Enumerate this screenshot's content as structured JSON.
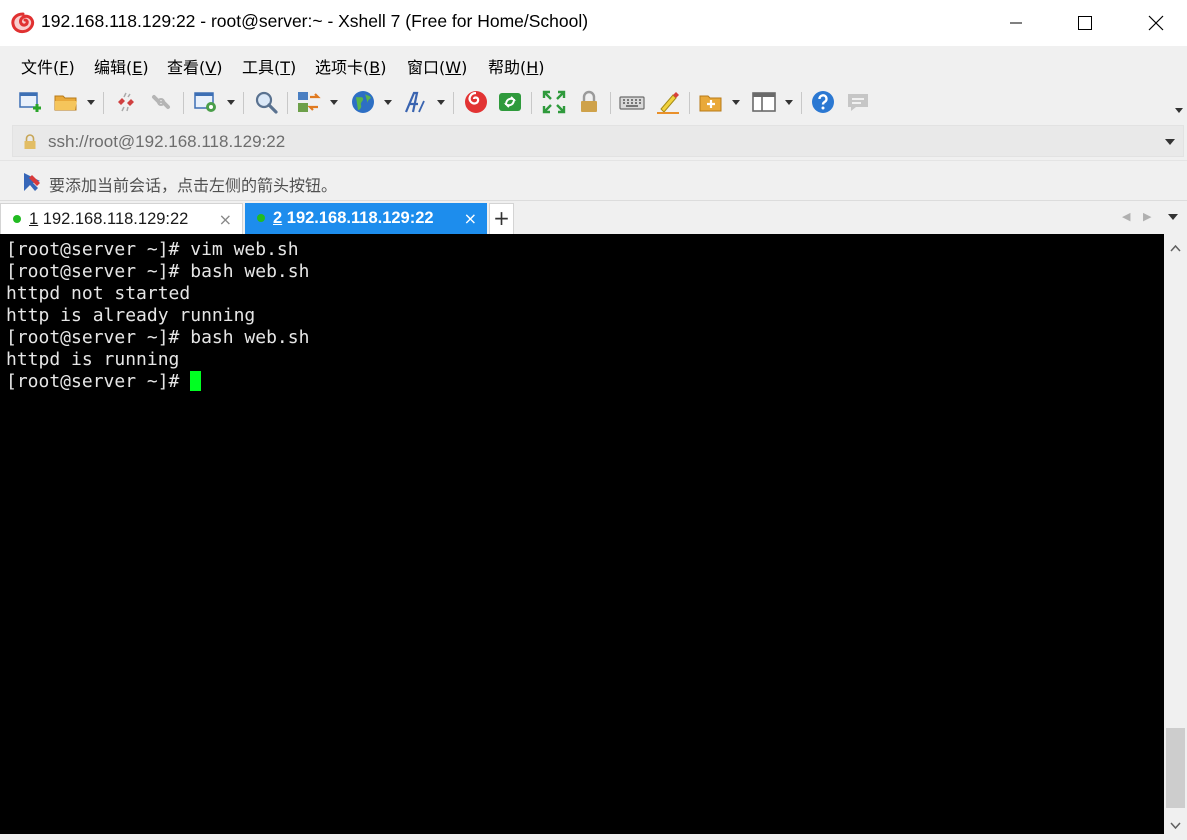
{
  "window": {
    "title": "192.168.118.129:22 - root@server:~ - Xshell 7 (Free for Home/School)"
  },
  "menu": {
    "items": [
      {
        "label": "文件",
        "key": "F"
      },
      {
        "label": "编辑",
        "key": "E"
      },
      {
        "label": "查看",
        "key": "V"
      },
      {
        "label": "工具",
        "key": "T"
      },
      {
        "label": "选项卡",
        "key": "B"
      },
      {
        "label": "窗口",
        "key": "W"
      },
      {
        "label": "帮助",
        "key": "H"
      }
    ]
  },
  "toolbar": {
    "icons": [
      "new-session-icon",
      "open-folder-icon",
      "disconnect-icon",
      "reconnect-icon",
      "properties-icon",
      "find-icon",
      "transfer-icon",
      "globe-icon",
      "font-icon",
      "xshell-icon",
      "xftp-icon",
      "fullscreen-icon",
      "lock-icon",
      "keyboard-icon",
      "highlight-icon",
      "new-folder-icon",
      "layout-icon",
      "help-icon",
      "chat-icon"
    ]
  },
  "address": {
    "value": "ssh://root@192.168.118.129:22"
  },
  "hint": {
    "text": "要添加当前会话，点击左侧的箭头按钮。"
  },
  "tabs": [
    {
      "num": "1",
      "label": " 192.168.118.129:22",
      "close": "×",
      "active": false
    },
    {
      "num": "2",
      "label": " 192.168.118.129:22",
      "close": "×",
      "active": true
    }
  ],
  "tab_add": "+",
  "terminal": {
    "lines": [
      "[root@server ~]# vim web.sh",
      "[root@server ~]# bash web.sh",
      "httpd not started",
      "http is already running",
      "[root@server ~]# bash web.sh",
      "httpd is running",
      "[root@server ~]# "
    ]
  },
  "colors": {
    "active_tab": "#1d8ded",
    "cursor": "#00ff22",
    "terminal_bg": "#000000",
    "status_dot": "#22bb22"
  }
}
